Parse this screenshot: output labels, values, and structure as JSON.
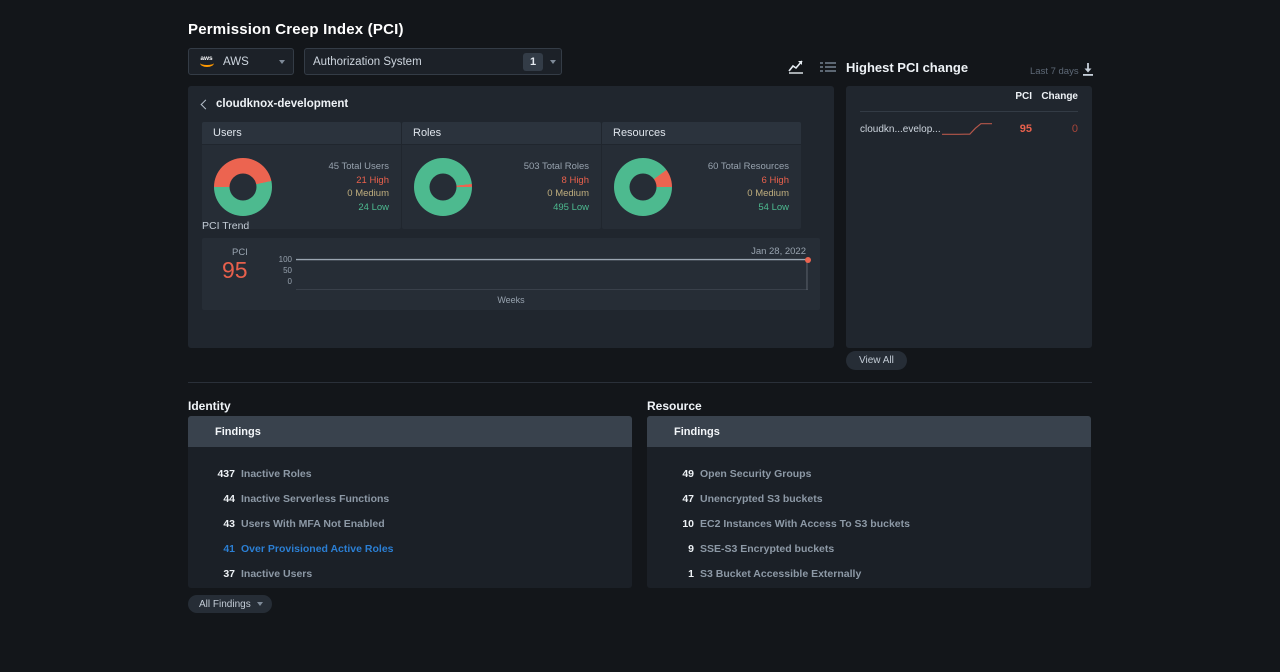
{
  "header": {
    "title": "Permission Creep Index (PCI)",
    "cloud_select": {
      "label": "AWS",
      "icon": "aws-logo"
    },
    "auth_select": {
      "label": "Authorization System",
      "count": "1"
    },
    "view_toggles": [
      {
        "name": "chart-view-toggle",
        "icon": "line-chart-icon",
        "active": true
      },
      {
        "name": "list-view-toggle",
        "icon": "list-icon",
        "active": false
      }
    ]
  },
  "highest_pci_change": {
    "title": "Highest PCI change",
    "range": "Last 7 days",
    "download_icon": "download-icon",
    "columns": [
      "PCI",
      "Change"
    ],
    "rows": [
      {
        "name": "cloudkn...evelop...",
        "pci": "95",
        "change": "0",
        "sparkline": [
          12,
          12,
          12,
          12,
          13,
          13,
          55,
          88,
          88,
          88
        ]
      }
    ],
    "view_all_label": "View All"
  },
  "main_panel": {
    "breadcrumb": "cloudknox-development",
    "cards": [
      {
        "title": "Users",
        "total_label": "45 Total Users",
        "total": 45,
        "high_label": "21 High",
        "high": 21,
        "medium_label": "0 Medium",
        "medium": 0,
        "low_label": "24 Low",
        "low": 24
      },
      {
        "title": "Roles",
        "total_label": "503 Total Roles",
        "total": 503,
        "high_label": "8 High",
        "high": 8,
        "medium_label": "0 Medium",
        "medium": 0,
        "low_label": "495 Low",
        "low": 495
      },
      {
        "title": "Resources",
        "total_label": "60 Total Resources",
        "total": 60,
        "high_label": "6 High",
        "high": 6,
        "medium_label": "0 Medium",
        "medium": 0,
        "low_label": "54 Low",
        "low": 54
      }
    ],
    "trend": {
      "title": "PCI Trend",
      "pci_caption": "PCI",
      "pci_value": "95",
      "date": "Jan 28, 2022",
      "y_ticks": [
        "100",
        "50",
        "0"
      ],
      "x_label": "Weeks"
    }
  },
  "findings": {
    "identity": {
      "section_title": "Identity",
      "header": "Findings",
      "rows": [
        {
          "count": "437",
          "label": "Inactive Roles",
          "highlight": false
        },
        {
          "count": "44",
          "label": "Inactive Serverless Functions",
          "highlight": false
        },
        {
          "count": "43",
          "label": "Users With MFA Not Enabled",
          "highlight": false
        },
        {
          "count": "41",
          "label": "Over Provisioned Active Roles",
          "highlight": true
        },
        {
          "count": "37",
          "label": "Inactive Users",
          "highlight": false
        }
      ]
    },
    "resource": {
      "section_title": "Resource",
      "header": "Findings",
      "rows": [
        {
          "count": "49",
          "label": "Open Security Groups",
          "highlight": false
        },
        {
          "count": "47",
          "label": "Unencrypted S3 buckets",
          "highlight": false
        },
        {
          "count": "10",
          "label": "EC2 Instances With Access To S3 buckets",
          "highlight": false
        },
        {
          "count": "9",
          "label": "SSE-S3 Encrypted buckets",
          "highlight": false
        },
        {
          "count": "1",
          "label": "S3 Bucket Accessible Externally",
          "highlight": false
        }
      ]
    },
    "all_findings_label": "All Findings"
  },
  "chart_data": [
    {
      "type": "pie",
      "title": "Users",
      "categories": [
        "High",
        "Medium",
        "Low"
      ],
      "values": [
        21,
        0,
        24
      ],
      "colors": [
        "#ec6450",
        "#bfae7e",
        "#4dba8f"
      ]
    },
    {
      "type": "pie",
      "title": "Roles",
      "categories": [
        "High",
        "Medium",
        "Low"
      ],
      "values": [
        8,
        0,
        495
      ],
      "colors": [
        "#ec6450",
        "#bfae7e",
        "#4dba8f"
      ]
    },
    {
      "type": "pie",
      "title": "Resources",
      "categories": [
        "High",
        "Medium",
        "Low"
      ],
      "values": [
        6,
        0,
        54
      ],
      "colors": [
        "#ec6450",
        "#bfae7e",
        "#4dba8f"
      ]
    },
    {
      "type": "line",
      "title": "PCI Trend",
      "xlabel": "Weeks",
      "ylabel": "PCI",
      "ylim": [
        0,
        100
      ],
      "yticks": [
        0,
        50,
        100
      ],
      "x": [
        0,
        1,
        2,
        3,
        4,
        5,
        6,
        7,
        8,
        9,
        10
      ],
      "values": [
        95,
        95,
        95,
        95,
        95,
        95,
        95,
        95,
        95,
        95,
        95
      ],
      "endpoint_label": "Jan 28, 2022",
      "endpoint_value": 95,
      "color": "#9aa5b1"
    },
    {
      "type": "line",
      "title": "cloudkn...evelop... sparkline",
      "x": [
        0,
        1,
        2,
        3,
        4,
        5,
        6,
        7,
        8,
        9
      ],
      "values": [
        12,
        12,
        12,
        12,
        13,
        13,
        55,
        88,
        88,
        88
      ],
      "ylim": [
        0,
        100
      ],
      "color": "#b4564a"
    }
  ],
  "colors": {
    "background": "#13161a",
    "panel": "#20262e",
    "card": "#262d36",
    "accent_high": "#ec6450",
    "accent_low": "#4dba8f",
    "accent_link": "#2b7fd4"
  }
}
